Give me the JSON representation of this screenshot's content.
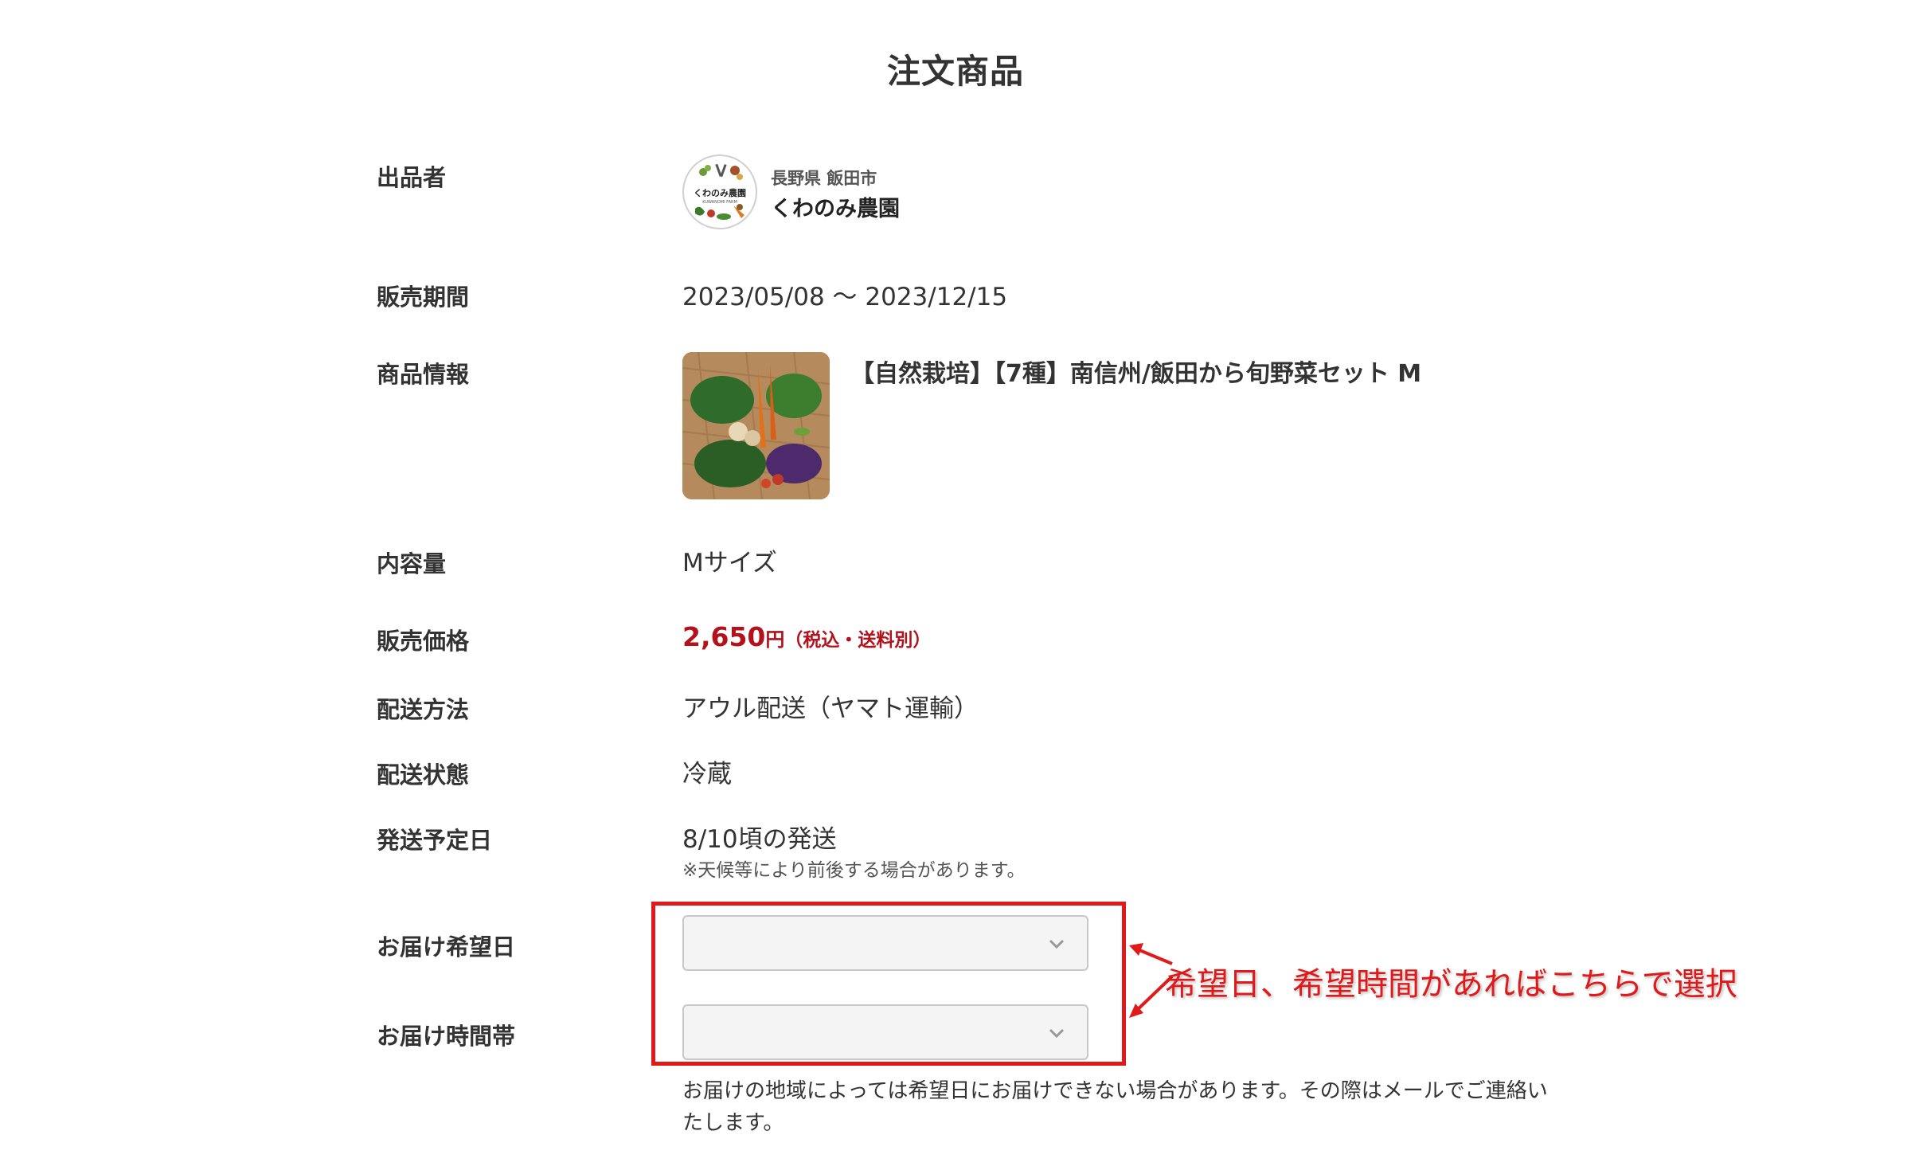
{
  "page": {
    "title": "注文商品"
  },
  "seller": {
    "label": "出品者",
    "region": "長野県 飯田市",
    "name": "くわのみ農園",
    "logo_text": "くわのみ農園",
    "logo_subtext": "KUWANOMI FARM"
  },
  "sale_period": {
    "label": "販売期間",
    "value": "2023/05/08 〜 2023/12/15"
  },
  "product": {
    "label": "商品情報",
    "name": "【自然栽培】【7種】南信州/飯田から旬野菜セット M"
  },
  "quantity": {
    "label": "内容量",
    "value": "Mサイズ"
  },
  "price": {
    "label": "販売価格",
    "amount": "2,650",
    "unit": "円",
    "note": "（税込・送料別）",
    "color": "#b3121c"
  },
  "shipping_method": {
    "label": "配送方法",
    "value": "アウル配送（ヤマト運輸）"
  },
  "shipping_state": {
    "label": "配送状態",
    "value": "冷蔵"
  },
  "ship_date": {
    "label": "発送予定日",
    "value": "8/10頃の発送",
    "note": "※天候等により前後する場合があります。"
  },
  "delivery_date": {
    "label": "お届け希望日",
    "selected": ""
  },
  "delivery_time": {
    "label": "お届け時間帯",
    "selected": ""
  },
  "footnote": "お届けの地域によっては希望日にお届けできない場合があります。その際はメールでご連絡いたします。",
  "annotation": {
    "text": "希望日、希望時間があればこちらで選択",
    "color": "#e01a1a"
  },
  "icons": {
    "select_chevron": "chevron-down-icon",
    "seller_logo": "farm-logo-icon",
    "annotation_arrow": "arrow-left-icon"
  }
}
